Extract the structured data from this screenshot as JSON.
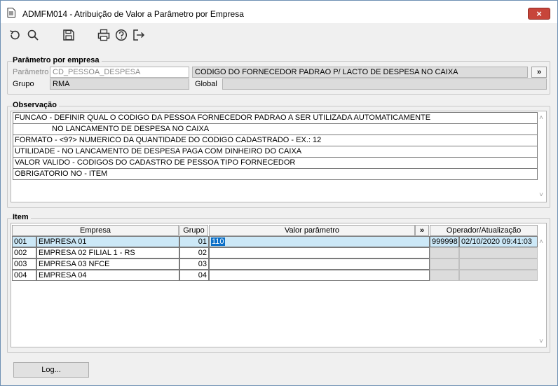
{
  "window": {
    "title": "ADMFM014 - Atribuição de Valor a Parâmetro por Empresa",
    "close_label": "×"
  },
  "toolbar": {
    "icons": [
      "undo-icon",
      "search-icon",
      "save-icon",
      "print-icon",
      "help-icon",
      "exit-icon"
    ]
  },
  "parametro": {
    "section_title": "Parâmetro por empresa",
    "param_label": "Parâmetro",
    "param_value": "CD_PESSOA_DESPESA",
    "param_desc": "CODIGO DO FORNECEDOR PADRAO P/ LACTO DE DESPESA NO CAIXA",
    "lookup_label": "»",
    "grupo_label": "Grupo",
    "grupo_value": "RMA",
    "global_label": "Global",
    "global_value": ""
  },
  "observacao": {
    "section_title": "Observação",
    "lines": [
      "FUNCAO - DEFINIR QUAL O CODIGO DA PESSOA FORNECEDOR PADRAO A SER UTILIZADA AUTOMATICAMENTE",
      "NO LANCAMENTO DE DESPESA NO CAIXA",
      "FORMATO - <9?> NUMERICO DA QUANTIDADE DO CODIGO CADASTRADO - EX.: 12",
      "UTILIDADE - NO LANCAMENTO DE DESPESA PAGA COM DINHEIRO DO CAIXA",
      "VALOR VALIDO - CODIGOS DO CADASTRO DE PESSOA TIPO FORNECEDOR",
      "OBRIGATORIO NO - ITEM"
    ]
  },
  "item": {
    "section_title": "Item",
    "headers": {
      "empresa": "Empresa",
      "grupo": "Grupo",
      "valor": "Valor parâmetro",
      "expand": "»",
      "operador": "Operador/Atualização"
    },
    "rows": [
      {
        "code": "001",
        "empresa": "EMPRESA 01",
        "grupo": "01",
        "valor": "110",
        "operador": "999998",
        "data": "02/10/2020 09:41:03"
      },
      {
        "code": "002",
        "empresa": "EMPRESA 02 FILIAL 1 - RS",
        "grupo": "02",
        "valor": "",
        "operador": "",
        "data": ""
      },
      {
        "code": "003",
        "empresa": "EMPRESA 03 NFCE",
        "grupo": "03",
        "valor": "",
        "operador": "",
        "data": ""
      },
      {
        "code": "004",
        "empresa": "EMPRESA 04",
        "grupo": "04",
        "valor": "",
        "operador": "",
        "data": ""
      }
    ]
  },
  "footer": {
    "log_label": "Log..."
  },
  "scroll": {
    "up": "˄",
    "down": "˅"
  }
}
